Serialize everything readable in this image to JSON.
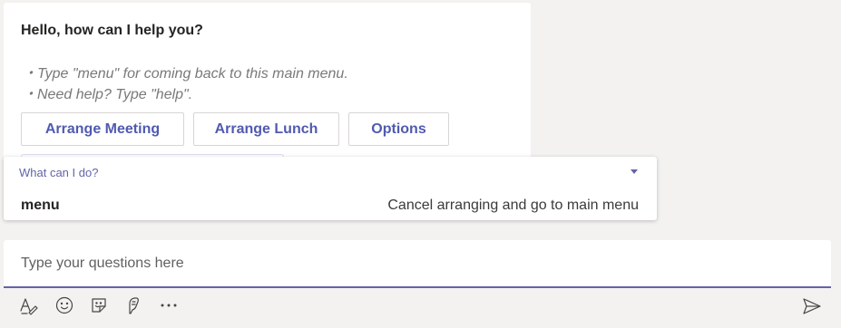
{
  "card": {
    "title": "Hello, how can I help you?",
    "bullets": [
      "・Type \"menu\" for coming back to this main menu.",
      "・Need help? Type \"help\"."
    ],
    "buttons": [
      "Arrange Meeting",
      "Arrange Lunch",
      "Options"
    ]
  },
  "popup": {
    "header": "What can I do?",
    "items": [
      {
        "command": "menu",
        "description": "Cancel arranging and go to main menu"
      }
    ]
  },
  "compose": {
    "placeholder": "Type your questions here",
    "value": ""
  },
  "toolbar": {
    "icons": [
      "format-icon",
      "emoji-icon",
      "sticker-icon",
      "praise-icon",
      "more-options-icon"
    ],
    "send_icon": "send-icon"
  },
  "colors": {
    "accent": "#6264a7",
    "button_text": "#505ab0",
    "background": "#f3f2f1"
  }
}
